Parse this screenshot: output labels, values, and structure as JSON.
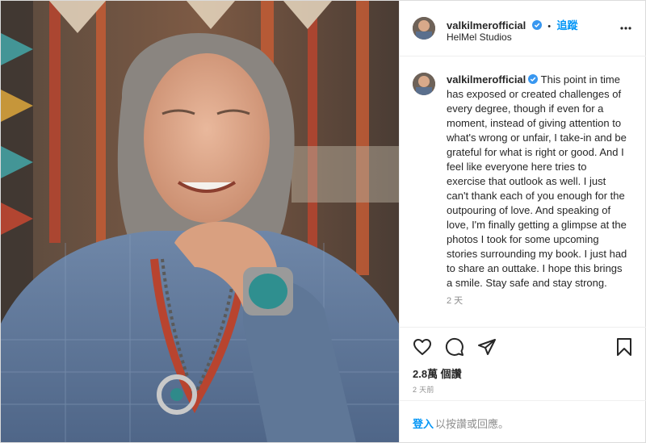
{
  "post": {
    "username": "valkilmerofficial",
    "follow_label": "追蹤",
    "separator": "•",
    "location": "HelMel Studios",
    "caption": "This point in time has exposed or created challenges of every degree, though if even for a moment, instead of giving attention to what's wrong or unfair, I take-in and be grateful for what is right or good. And I feel like everyone here tries to exercise that outlook as well. I just can't thank each of you enough for the outpouring of love. And speaking of love, I'm finally getting a glimpse at the photos I took for some upcoming stories surrounding my book. I just had to share an outtake. I hope this brings a smile. Stay safe and stay strong.",
    "caption_age": "2 天",
    "likes": "2.8萬 個讚",
    "posted": "2 天前",
    "login_link": "登入",
    "login_prompt": "以按讚或回應。"
  },
  "icons": {
    "more": "more-options-icon",
    "like": "heart-icon",
    "comment": "comment-icon",
    "share": "share-icon",
    "save": "bookmark-icon",
    "verified": "verified-badge-icon"
  },
  "colors": {
    "link": "#0095f6",
    "verified": "#3897f0",
    "muted": "#8e8e8e"
  }
}
